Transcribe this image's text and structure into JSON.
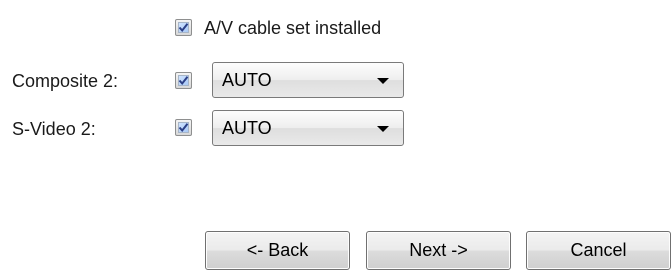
{
  "av_cable": {
    "label": "A/V cable set installed",
    "checked": true
  },
  "rows": [
    {
      "label": "Composite 2:",
      "checked": true,
      "selected": "AUTO"
    },
    {
      "label": "S-Video 2:",
      "checked": true,
      "selected": "AUTO"
    }
  ],
  "buttons": {
    "back": "<- Back",
    "next": "Next ->",
    "cancel": "Cancel"
  },
  "icons": {
    "checkmark": "check-icon",
    "dropdown": "chevron-down-icon"
  }
}
